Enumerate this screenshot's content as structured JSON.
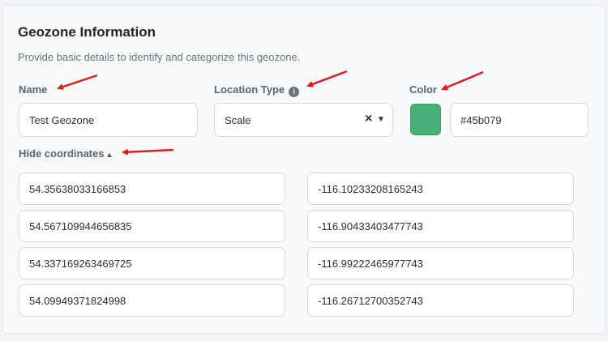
{
  "section": {
    "title": "Geozone Information",
    "description": "Provide basic details to identify and categorize this geozone."
  },
  "fields": {
    "name": {
      "label": "Name",
      "value": "Test Geozone"
    },
    "location_type": {
      "label": "Location Type",
      "value": "Scale",
      "info_icon": "info-icon",
      "clear_icon": "close-icon",
      "dropdown_icon": "chevron-down-icon"
    },
    "color": {
      "label": "Color",
      "value": "#45b079",
      "swatch_color": "#45b079"
    }
  },
  "coordinates": {
    "toggle_label": "Hide coordinates",
    "toggle_icon": "caret-up-icon",
    "rows": [
      {
        "lat": "54.35638033166853",
        "lng": "-116.10233208165243"
      },
      {
        "lat": "54.567109944656835",
        "lng": "-116.90433403477743"
      },
      {
        "lat": "54.337169263469725",
        "lng": "-116.99222465977743"
      },
      {
        "lat": "54.09949371824998",
        "lng": "-116.26712700352743"
      }
    ]
  },
  "annotations": {
    "arrow_color": "#e11b1b"
  }
}
